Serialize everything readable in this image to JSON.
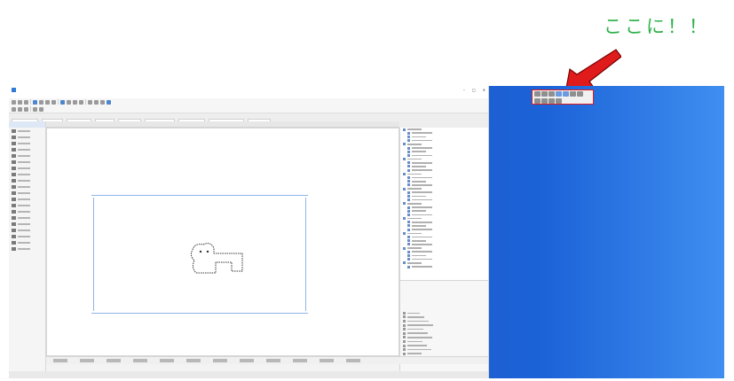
{
  "callout": {
    "text": "ここに！！",
    "color": "#2fb24a"
  },
  "arrow": {
    "color": "#e01b1b"
  },
  "desktop": {
    "background": "#1d52b8",
    "floating_palette": {
      "icons": [
        "zoom-in-icon",
        "zoom-out-icon",
        "fit-window-icon",
        "pan-icon",
        "orbit-icon",
        "previous-view-icon",
        "next-view-icon"
      ],
      "highlight_color": "#e01b1b"
    }
  },
  "app": {
    "window_controls": [
      "–",
      "□",
      "✕"
    ],
    "toolbox_items": [
      "wall-tool",
      "column-tool",
      "beam-tool",
      "slab-tool",
      "roof-tool",
      "shell-tool",
      "stair-tool",
      "railing-tool",
      "door-tool",
      "window-tool",
      "object-tool",
      "zone-tool",
      "mesh-tool",
      "dimension-tool",
      "text-tool",
      "label-tool",
      "fill-tool",
      "line-tool",
      "arc-tool",
      "polyline-tool"
    ],
    "navigator_rows": 38,
    "palette_rows": 12
  }
}
